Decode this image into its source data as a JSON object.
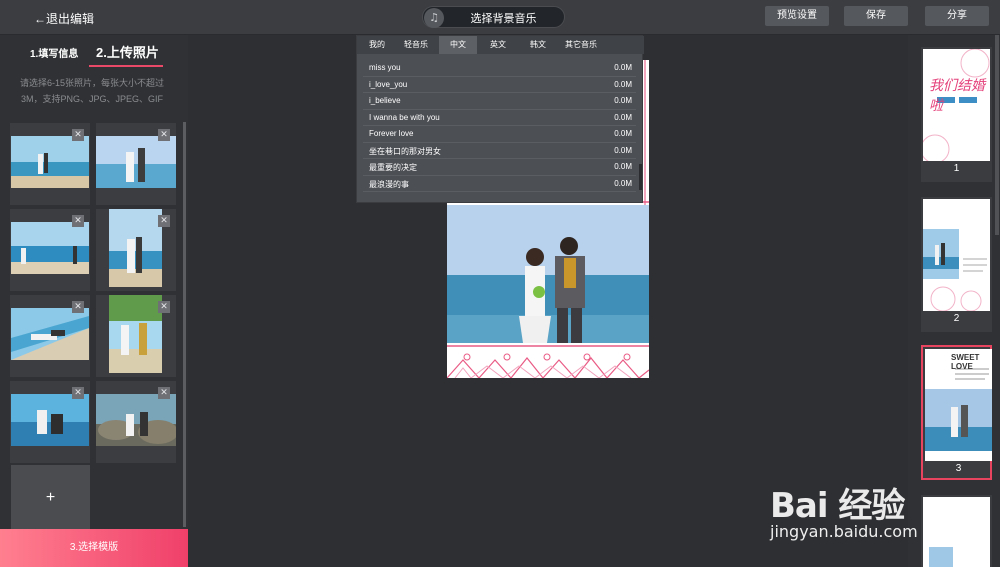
{
  "header": {
    "back_label": "←退出编辑",
    "music_label": "选择背景音乐",
    "music_icon": "music-note-icon",
    "preview_label": "预览设置",
    "save_label": "保存",
    "share_label": "分享"
  },
  "steps": {
    "step1": "1.填写信息",
    "step2": "2.上传照片",
    "step3": "3.选择模版"
  },
  "upload_hint": "请选择6-15张照片，每张大小不超过3M，支持PNG、JPG、JPEG、GIF",
  "add_label": "+",
  "delete_glyph": "✕",
  "music": {
    "tabs": [
      "我的",
      "轻音乐",
      "中文",
      "英文",
      "韩文",
      "其它音乐"
    ],
    "active_tab": "中文",
    "songs": [
      {
        "name": "miss you",
        "size": "0.0M"
      },
      {
        "name": "i_love_you",
        "size": "0.0M"
      },
      {
        "name": "i_believe",
        "size": "0.0M"
      },
      {
        "name": "I wanna be with you",
        "size": "0.0M"
      },
      {
        "name": "Forever love",
        "size": "0.0M"
      },
      {
        "name": "坐在巷口的那对男女",
        "size": "0.0M"
      },
      {
        "name": "最重要的决定",
        "size": "0.0M"
      },
      {
        "name": "最浪漫的事",
        "size": "0.0M"
      }
    ]
  },
  "templates": [
    {
      "num": "1",
      "title": "我们结婚啦"
    },
    {
      "num": "2",
      "title": ""
    },
    {
      "num": "3",
      "title": "SWEET LOVE"
    }
  ],
  "selected_template": "3",
  "watermark": {
    "brand": "Bai 经验",
    "url": "jingyan.baidu.com"
  },
  "colors": {
    "accent": "#ea4a68",
    "background": "#2b2c2f",
    "toolbar": "#3b3d41"
  }
}
